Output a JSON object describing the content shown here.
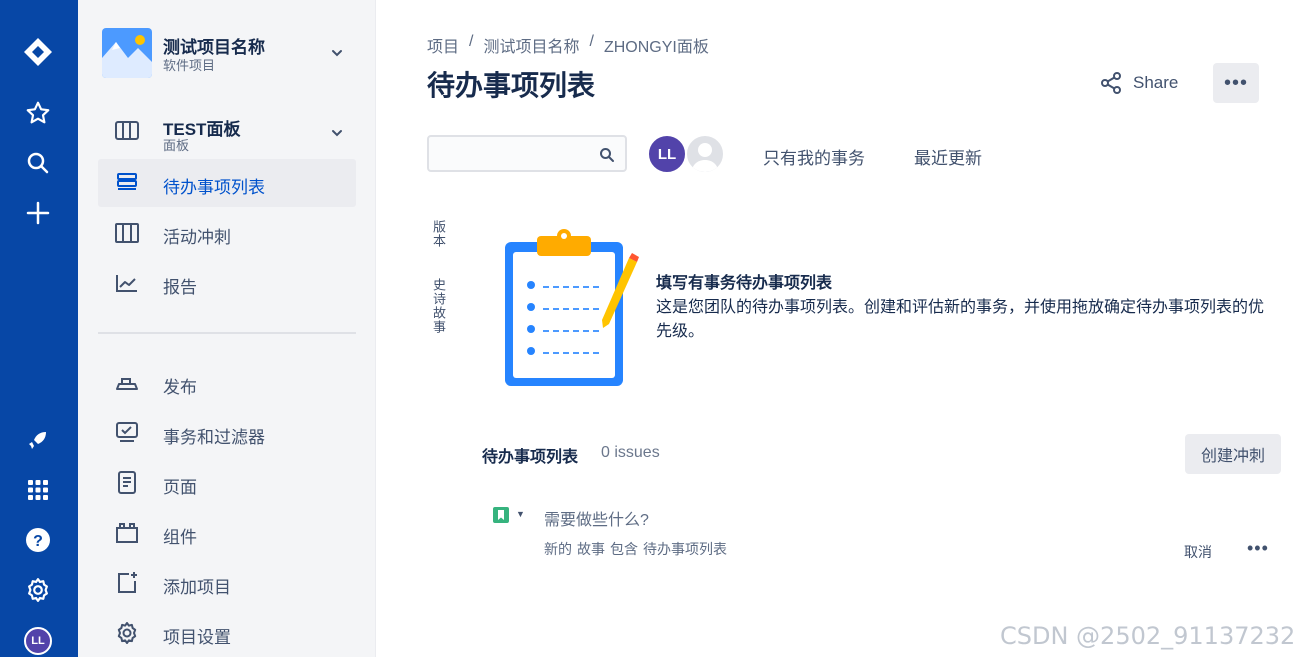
{
  "global_nav": {
    "user_initials": "LL"
  },
  "project": {
    "name": "测试项目名称",
    "type": "软件项目"
  },
  "board": {
    "name": "TEST面板",
    "type": "面板"
  },
  "nav_primary": [
    {
      "label": "待办事项列表",
      "icon": "backlog-icon",
      "active": true
    },
    {
      "label": "活动冲刺",
      "icon": "active-sprint-icon",
      "active": false
    },
    {
      "label": "报告",
      "icon": "reports-icon",
      "active": false
    }
  ],
  "nav_secondary": [
    {
      "label": "发布",
      "icon": "releases-icon"
    },
    {
      "label": "事务和过滤器",
      "icon": "issues-filters-icon"
    },
    {
      "label": "页面",
      "icon": "pages-icon"
    },
    {
      "label": "组件",
      "icon": "components-icon"
    },
    {
      "label": "添加项目",
      "icon": "add-item-icon"
    },
    {
      "label": "项目设置",
      "icon": "settings-icon"
    }
  ],
  "breadcrumbs": [
    "项目",
    "测试项目名称",
    "ZHONGYI面板"
  ],
  "breadcrumb_sep": "/",
  "page_title": "待办事项列表",
  "header_actions": {
    "share_label": "Share",
    "more_label": "•••"
  },
  "toolbar": {
    "search_placeholder": "",
    "avatar_initials": "LL",
    "quick_filters": [
      "只有我的事务",
      "最近更新"
    ]
  },
  "side_tabs": {
    "versions": "版本",
    "epics": "史诗故事"
  },
  "empty_state": {
    "title": "填写有事务待办事项列表",
    "description": "这是您团队的待办事项列表。创建和评估新的事务，并使用拖放确定待办事项列表的优先级。"
  },
  "backlog": {
    "title": "待办事项列表",
    "count": "0 issues",
    "create_sprint_label": "创建冲刺",
    "new_issue_placeholder": "需要做些什么?",
    "hint_parts": [
      "新的",
      "故事",
      "包含",
      "待办事项列表"
    ],
    "cancel_label": "取消",
    "more_label": "•••"
  },
  "watermark": "CSDN @2502_91137232",
  "colors": {
    "global_nav": "#0747a6",
    "sidebar_bg": "#f4f5f7",
    "active_text": "#0052cc",
    "avatar_purple": "#5243aa",
    "story_green": "#36b37e"
  }
}
